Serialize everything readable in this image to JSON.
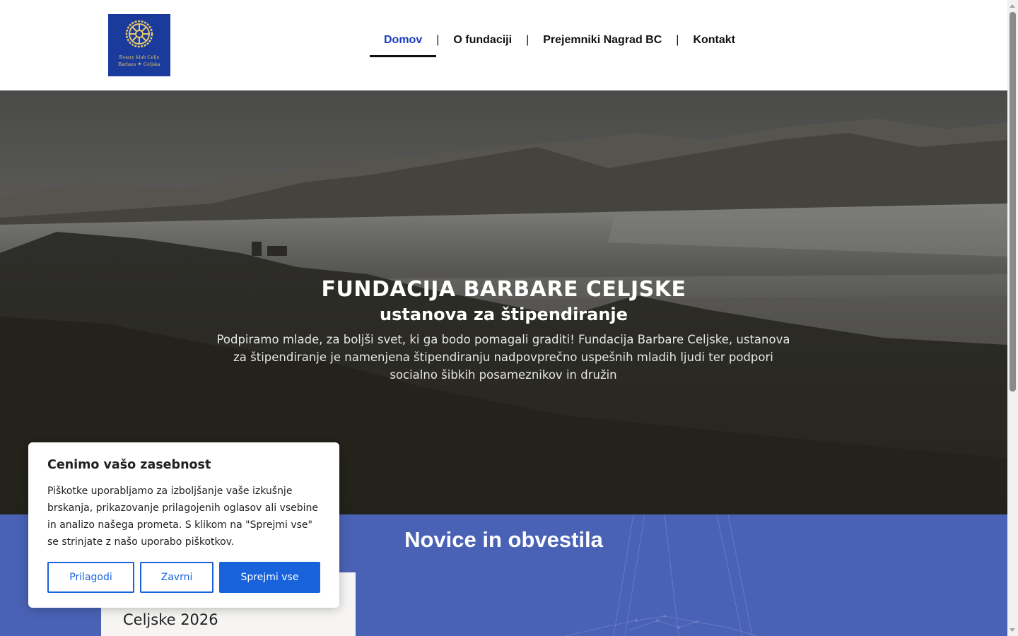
{
  "header": {
    "logo": {
      "icon": "rotary-wheel-icon",
      "line1": "Rotary klub Celje",
      "line2": "Barbara ✶ Celjska"
    },
    "nav": [
      {
        "label": "Domov",
        "active": true
      },
      {
        "label": "O fundaciji",
        "active": false
      },
      {
        "label": "Prejemniki Nagrad BC",
        "active": false
      },
      {
        "label": "Kontakt",
        "active": false
      }
    ],
    "separator": "|"
  },
  "hero": {
    "title": "FUNDACIJA BARBARE CELJSKE",
    "subtitle": "ustanova za štipendiranje",
    "description": "Podpiramo mlade, za boljši svet, ki ga bodo pomagali graditi! Fundacija Barbare Celjske, ustanova za štipendiranje je namenjena štipendiranju nadpovprečno uspešnih mladih ljudi ter podpori socialno šibkih posameznikov in družin"
  },
  "news": {
    "title": "Novice in obvestila",
    "card_title": "Celjske 2026"
  },
  "cookie": {
    "title": "Cenimo vašo zasebnost",
    "text": "Piškotke uporabljamo za izboljšanje vaše izkušnje brskanja, prikazovanje prilagojenih oglasov ali vsebine in analizo našega prometa. S klikom na \"Sprejmi vse\" se strinjate z našo uporabo piškotkov.",
    "customize_label": "Prilagodi",
    "reject_label": "Zavrni",
    "accept_label": "Sprejmi vse"
  },
  "colors": {
    "nav_active": "#1a3bbd",
    "logo_bg": "#1a3a9c",
    "news_bg": "#4a62b5",
    "button_primary": "#1863dc"
  }
}
